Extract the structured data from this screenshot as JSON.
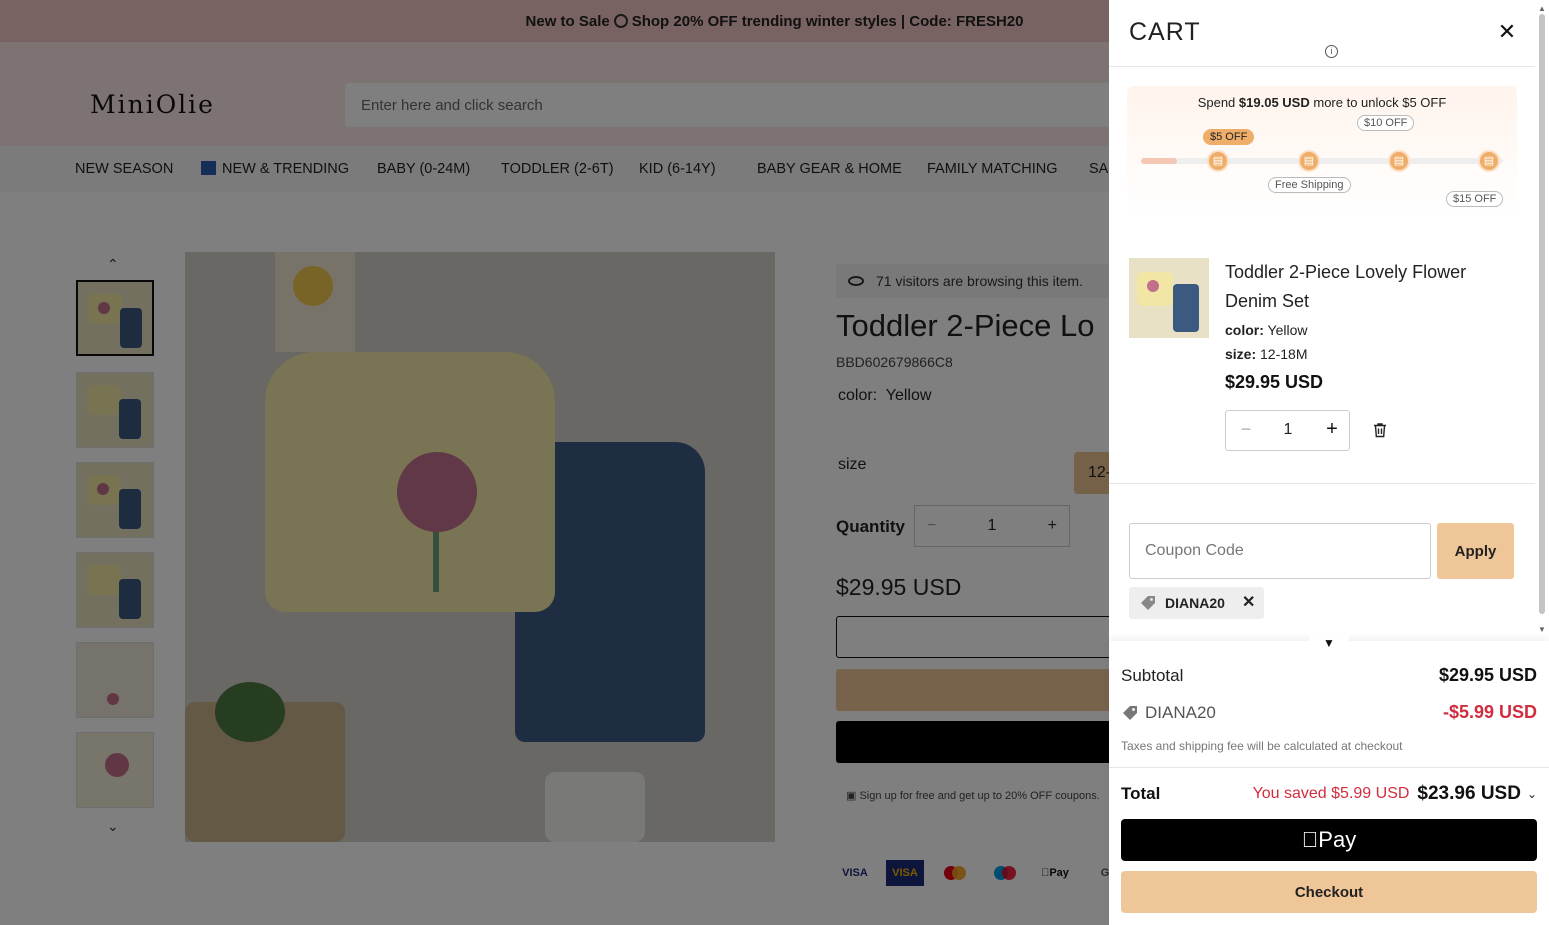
{
  "announcement": {
    "text_before": "New to Sale",
    "text_after": "Shop 20% OFF trending winter styles | Code: FRESH20"
  },
  "header": {
    "logo": "MiniOlie",
    "search_placeholder": "Enter here and click search"
  },
  "nav": {
    "items": [
      "NEW SEASON",
      "NEW & TRENDING",
      "BABY (0-24M)",
      "TODDLER (2-6T)",
      "KID (6-14Y)",
      "BABY GEAR & HOME",
      "FAMILY MATCHING",
      "SA"
    ]
  },
  "product": {
    "visitors": "71 visitors are browsing this item.",
    "title": "Toddler 2-Piece Lo",
    "sku": "BBD602679866C8",
    "color_label": "color:",
    "color_value": "Yellow",
    "size_label": "size",
    "size_chip": "12-",
    "quantity_label": "Quantity",
    "quantity": "1",
    "price": "$29.95 USD",
    "signup_text": "Sign up for free and get up to 20% OFF coupons.",
    "payment_methods": [
      "VISA",
      "VISA",
      "Mastercard",
      "Maestro",
      "Pay",
      "G"
    ]
  },
  "cart": {
    "title": "CART",
    "promo": {
      "prefix": "Spend",
      "amount": "$19.05 USD",
      "suffix": "more to unlock $5 OFF",
      "progress": 0.1,
      "tiers": [
        "$5 OFF",
        "Free Shipping",
        "$10 OFF",
        "$15 OFF"
      ]
    },
    "item": {
      "name": "Toddler 2-Piece Lovely Flower Denim Set",
      "color_label": "color:",
      "color_value": "Yellow",
      "size_label": "size:",
      "size_value": "12-18M",
      "price": "$29.95 USD",
      "quantity": "1"
    },
    "coupon": {
      "placeholder": "Coupon Code",
      "apply_label": "Apply",
      "applied_code": "DIANA20"
    },
    "summary": {
      "subtotal_label": "Subtotal",
      "subtotal_value": "$29.95 USD",
      "discount_code": "DIANA20",
      "discount_value": "-$5.99 USD",
      "tax_note": "Taxes and shipping fee will be calculated at checkout",
      "total_label": "Total",
      "saved_text": "You saved $5.99 USD",
      "total_value": "$23.96 USD",
      "applepay_label": "Pay",
      "checkout_label": "Checkout"
    }
  }
}
